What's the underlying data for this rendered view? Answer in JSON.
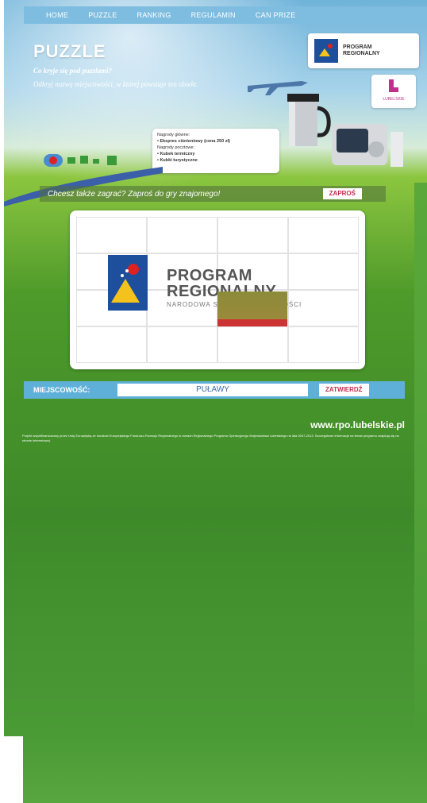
{
  "nav": {
    "items": [
      "HOME",
      "PUZZLE",
      "RANKING",
      "REGULAMIN",
      "CAN PRIZE"
    ]
  },
  "header": {
    "title": "PUZZLE",
    "tagline": "Co kryje się pod puzzlami?",
    "intro": "Odkryj nazwę miejscowości, w której powstaje ten obiekt."
  },
  "sponsors": {
    "main_logo_text": "PROGRAM REGIONALNY",
    "secondary_logo_text": "LUBELSKIE"
  },
  "prizes": {
    "lines": [
      "Nagrody główne:",
      "• Ekspres ciśnieniowy (cena 250 zł)",
      "Nagrody pocztowe:",
      "• Kubek termiczny",
      "• Kubki turystyczne"
    ]
  },
  "invite": {
    "text": "Chcesz także zagrać? Zaproś do gry znajomego!",
    "button": "ZAPROŚ"
  },
  "puzzle": {
    "program_line1": "PROGRAM",
    "program_line2": "REGIONALNY",
    "program_sub": "NARODOWA STRATEGIA SPÓJNOŚCI"
  },
  "location": {
    "label": "MIEJSCOWOŚĆ:",
    "value": "PUŁAWY",
    "submit": "ZATWIERDŹ"
  },
  "footer": {
    "url": "www.rpo.lubelskie.pl",
    "note": "Projekt współfinansowany przez Unię Europejską ze środków Europejskiego Funduszu Rozwoju Regionalnego w ramach Regionalnego Programu Operacyjnego Województwa Lubelskiego na lata 2007-2013. Szczegółowe informacje na temat programu znajdują się na stronie internetowej."
  }
}
